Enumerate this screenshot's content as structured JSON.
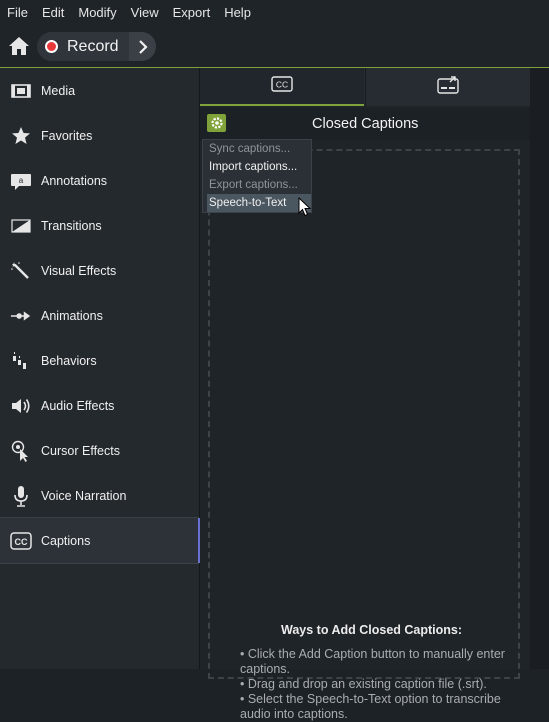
{
  "menubar": [
    "File",
    "Edit",
    "Modify",
    "View",
    "Export",
    "Help"
  ],
  "toolbar": {
    "record_label": "Record"
  },
  "sidebar": {
    "items": [
      {
        "label": "Media",
        "icon": "media-filmstrip-icon"
      },
      {
        "label": "Favorites",
        "icon": "star-icon"
      },
      {
        "label": "Annotations",
        "icon": "annotation-callout-icon"
      },
      {
        "label": "Transitions",
        "icon": "transition-icon"
      },
      {
        "label": "Visual Effects",
        "icon": "magic-wand-icon"
      },
      {
        "label": "Animations",
        "icon": "animation-arrow-icon"
      },
      {
        "label": "Behaviors",
        "icon": "behaviors-icon"
      },
      {
        "label": "Audio Effects",
        "icon": "speaker-icon"
      },
      {
        "label": "Cursor Effects",
        "icon": "cursor-effects-icon"
      },
      {
        "label": "Voice Narration",
        "icon": "microphone-icon"
      },
      {
        "label": "Captions",
        "icon": "captions-cc-icon",
        "active": true
      }
    ]
  },
  "panel": {
    "title": "Closed Captions",
    "tabs": [
      {
        "icon": "closed-captions-icon",
        "active": true
      },
      {
        "icon": "dynamic-captions-icon"
      }
    ]
  },
  "dropdown": {
    "items": [
      {
        "label": "Sync captions...",
        "enabled": false
      },
      {
        "label": "Import captions...",
        "enabled": true
      },
      {
        "label": "Export captions...",
        "enabled": false
      },
      {
        "label": "Speech-to-Text",
        "enabled": true,
        "highlighted": true
      }
    ]
  },
  "empty_state": {
    "title": "Ways to Add Closed Captions:",
    "bullets": [
      "• Click the Add Caption button to manually enter captions.",
      "• Drag and drop an existing caption file (.srt).",
      "• Select the Speech-to-Text option to transcribe audio into captions."
    ]
  },
  "colors": {
    "accent": "#7fa23a",
    "active_indicator": "#6a6fd2",
    "record": "#e8383a"
  }
}
